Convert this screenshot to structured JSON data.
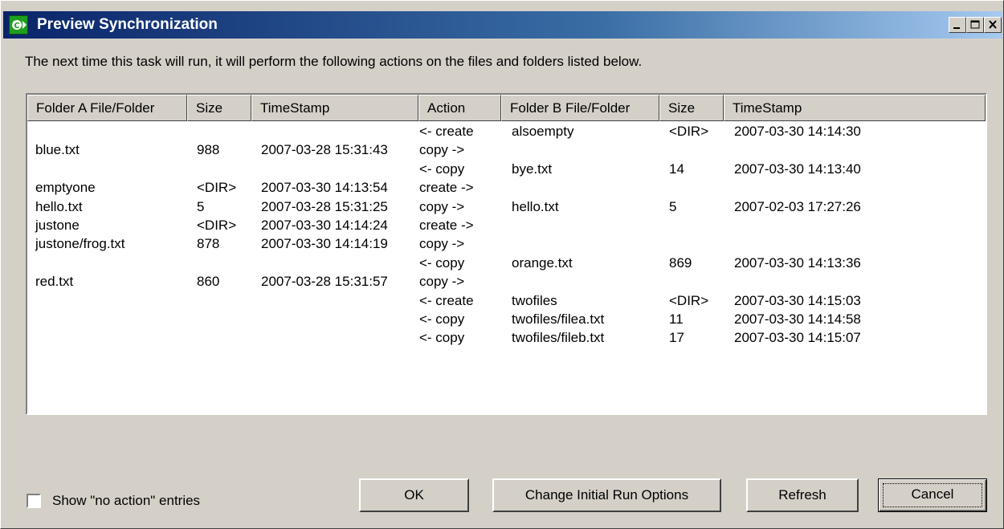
{
  "window": {
    "title": "Preview Synchronization",
    "controls": [
      "minimize-icon",
      "maximize-icon",
      "close-icon"
    ]
  },
  "intro_text": "The next time this task will run, it will perform the following actions on the files and folders listed below.",
  "columns": [
    "Folder A File/Folder",
    "Size",
    "TimeStamp",
    "Action",
    "Folder B File/Folder",
    "Size",
    "TimeStamp"
  ],
  "rows": [
    [
      "",
      "",
      "",
      "<- create",
      "alsoempty",
      "<DIR>",
      "2007-03-30 14:14:30"
    ],
    [
      "blue.txt",
      "988",
      "2007-03-28 15:31:43",
      "copy ->",
      "",
      "",
      ""
    ],
    [
      "",
      "",
      "",
      "<- copy",
      "bye.txt",
      "14",
      "2007-03-30 14:13:40"
    ],
    [
      "emptyone",
      "<DIR>",
      "2007-03-30 14:13:54",
      "create ->",
      "",
      "",
      ""
    ],
    [
      "hello.txt",
      "5",
      "2007-03-28 15:31:25",
      "copy ->",
      "hello.txt",
      "5",
      "2007-02-03 17:27:26"
    ],
    [
      "justone",
      "<DIR>",
      "2007-03-30 14:14:24",
      "create ->",
      "",
      "",
      ""
    ],
    [
      "justone/frog.txt",
      "878",
      "2007-03-30 14:14:19",
      "copy ->",
      "",
      "",
      ""
    ],
    [
      "",
      "",
      "",
      "<- copy",
      "orange.txt",
      "869",
      "2007-03-30 14:13:36"
    ],
    [
      "red.txt",
      "860",
      "2007-03-28 15:31:57",
      "copy ->",
      "",
      "",
      ""
    ],
    [
      "",
      "",
      "",
      "<- create",
      "twofiles",
      "<DIR>",
      "2007-03-30 14:15:03"
    ],
    [
      "",
      "",
      "",
      "<- copy",
      "twofiles/filea.txt",
      "11",
      "2007-03-30 14:14:58"
    ],
    [
      "",
      "",
      "",
      "<- copy",
      "twofiles/fileb.txt",
      "17",
      "2007-03-30 14:15:07"
    ]
  ],
  "checkbox": {
    "label": "Show \"no action\" entries",
    "checked": false
  },
  "buttons": {
    "ok": "OK",
    "change_initial": "Change Initial Run Options",
    "refresh": "Refresh",
    "cancel": "Cancel"
  },
  "colors": {
    "titlebar_start": "#0a246a",
    "titlebar_end": "#a6caf0",
    "face": "#d4d0c8",
    "app_icon": "#1e9e1e"
  }
}
